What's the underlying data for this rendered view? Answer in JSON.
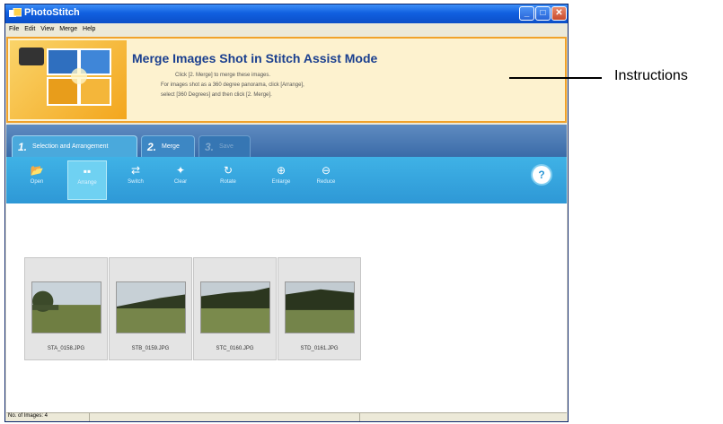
{
  "window": {
    "title": "PhotoStitch",
    "controls": [
      "minimize",
      "maximize",
      "close"
    ]
  },
  "menu": [
    "File",
    "Edit",
    "View",
    "Merge",
    "Help"
  ],
  "banner": {
    "heading": "Merge Images Shot in Stitch Assist Mode",
    "lines": [
      "Click [2. Merge] to merge these images.",
      "For images shot as a 360 degree panorama, click [Arrange],",
      "select [360 Degrees] and then click [2. Merge]."
    ]
  },
  "tabs": [
    {
      "num": "1.",
      "label": "Selection and Arrangement",
      "state": "active"
    },
    {
      "num": "2.",
      "label": "Merge",
      "state": "inactive"
    },
    {
      "num": "3.",
      "label": "Save",
      "state": "disabled"
    }
  ],
  "toolbar": [
    {
      "label": "Open",
      "icon": "open-icon",
      "glyph": "📂"
    },
    {
      "label": "Arrange",
      "icon": "arrange-icon",
      "glyph": "▪▪"
    },
    {
      "label": "Switch",
      "icon": "switch-icon",
      "glyph": "⇄"
    },
    {
      "label": "Clear",
      "icon": "clear-icon",
      "glyph": "✦"
    },
    {
      "label": "Rotate",
      "icon": "rotate-icon",
      "glyph": "↻"
    },
    {
      "label": "Enlarge",
      "icon": "enlarge-icon",
      "glyph": "⊕"
    },
    {
      "label": "Reduce",
      "icon": "reduce-icon",
      "glyph": "⊖"
    }
  ],
  "help": "?",
  "images": [
    {
      "caption": "STA_0158.JPG"
    },
    {
      "caption": "STB_0159.JPG"
    },
    {
      "caption": "STC_0160.JPG"
    },
    {
      "caption": "STD_0161.JPG"
    }
  ],
  "status": {
    "text": "No. of Images: 4"
  },
  "callout": {
    "label": "Instructions"
  }
}
